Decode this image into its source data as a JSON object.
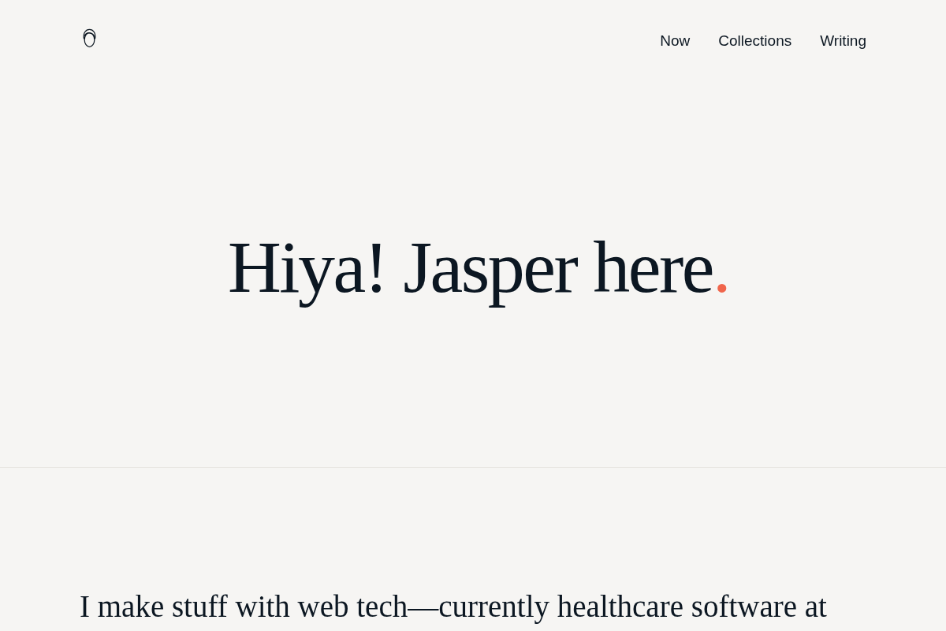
{
  "header": {
    "nav": [
      {
        "label": "Now"
      },
      {
        "label": "Collections"
      },
      {
        "label": "Writing"
      }
    ]
  },
  "hero": {
    "heading": "Hiya! Jasper here",
    "heading_end": "."
  },
  "intro": {
    "text": "I make stuff with web tech—currently healthcare software at"
  }
}
